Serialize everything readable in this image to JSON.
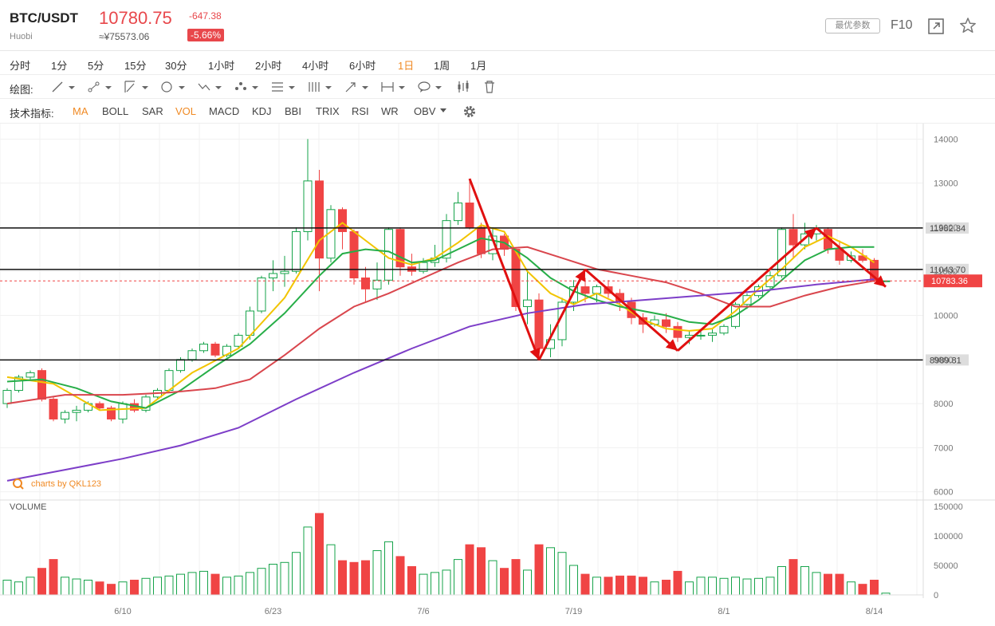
{
  "header": {
    "symbol": "BTC/USDT",
    "exchange": "Huobi",
    "price": "10780.75",
    "cny_price": "≈¥75573.06",
    "change": "-647.38",
    "change_pct": "-5.66%",
    "params_label": "最优参数",
    "f10_label": "F10",
    "icons": [
      "expand-icon",
      "star-icon"
    ]
  },
  "periods": [
    {
      "label": "分时",
      "active": false
    },
    {
      "label": "1分",
      "active": false
    },
    {
      "label": "5分",
      "active": false
    },
    {
      "label": "15分",
      "active": false
    },
    {
      "label": "30分",
      "active": false
    },
    {
      "label": "1小时",
      "active": false
    },
    {
      "label": "2小时",
      "active": false
    },
    {
      "label": "4小时",
      "active": false
    },
    {
      "label": "6小时",
      "active": false
    },
    {
      "label": "1日",
      "active": true
    },
    {
      "label": "1周",
      "active": false
    },
    {
      "label": "1月",
      "active": false
    }
  ],
  "drawing": {
    "label": "绘图:",
    "tools": [
      "line-tool-icon",
      "ray-tool-icon",
      "channel-tool-icon",
      "shape-tool-icon",
      "wave-tool-icon",
      "pattern-tool-icon",
      "fib-tool-icon",
      "gann-tool-icon",
      "arrow-tool-icon",
      "measure-tool-icon",
      "annotation-tool-icon",
      "candle-tool-icon",
      "trash-icon"
    ]
  },
  "indicators": {
    "label": "技术指标:",
    "items": [
      {
        "label": "MA",
        "active": true
      },
      {
        "label": "BOLL",
        "active": false
      },
      {
        "label": "SAR",
        "active": false
      },
      {
        "label": "VOL",
        "active": true
      },
      {
        "label": "MACD",
        "active": false
      },
      {
        "label": "KDJ",
        "active": false
      },
      {
        "label": "BBI",
        "active": false
      },
      {
        "label": "TRIX",
        "active": false
      },
      {
        "label": "RSI",
        "active": false
      },
      {
        "label": "WR",
        "active": false
      },
      {
        "label": "OBV",
        "active": false
      }
    ]
  },
  "colors": {
    "up": "#16a34a",
    "down": "#f04444",
    "ma5": "#f2c400",
    "ma10": "#27ae48",
    "ma30": "#d9464d",
    "ma60": "#7d3ec8",
    "annotation": "#e01010",
    "accent": "#f08a24"
  },
  "chart_data": {
    "type": "candlestick",
    "watermark": "charts by QKL123",
    "volume_label": "VOLUME",
    "price_axis": {
      "ticks": [
        "14000",
        "13000",
        "12000",
        "11000",
        "10000",
        "9000",
        "8000",
        "7000",
        "6000"
      ],
      "range": [
        5850,
        14350
      ]
    },
    "volume_axis": {
      "ticks": [
        "150000",
        "100000",
        "50000",
        "0"
      ],
      "range": [
        0,
        150000
      ]
    },
    "x_labels": [
      {
        "label": "6/10",
        "index": 10
      },
      {
        "label": "6/23",
        "index": 23
      },
      {
        "label": "7/6",
        "index": 36
      },
      {
        "label": "7/19",
        "index": 49
      },
      {
        "label": "8/1",
        "index": 62
      },
      {
        "label": "8/14",
        "index": 75
      }
    ],
    "horizontal_levels": [
      {
        "label": "11982.34",
        "value": 11982.34
      },
      {
        "label": "11043.70",
        "value": 11043.7
      },
      {
        "label": "8989.81",
        "value": 8989.81
      }
    ],
    "last_price": {
      "label": "10783.36",
      "value": 10783.36
    },
    "candles": [
      [
        8000,
        8300,
        8350,
        7900,
        25000
      ],
      [
        8300,
        8600,
        8650,
        8250,
        22000
      ],
      [
        8600,
        8700,
        8750,
        8550,
        30000
      ],
      [
        8750,
        8100,
        8800,
        8050,
        45000
      ],
      [
        8100,
        7650,
        8150,
        7600,
        60000
      ],
      [
        7650,
        7800,
        7850,
        7550,
        30000
      ],
      [
        7800,
        7850,
        7950,
        7600,
        27000
      ],
      [
        7850,
        8000,
        8050,
        7800,
        25000
      ],
      [
        8000,
        7900,
        8050,
        7850,
        22000
      ],
      [
        7900,
        7650,
        7950,
        7600,
        18000
      ],
      [
        7650,
        8000,
        8050,
        7550,
        22000
      ],
      [
        8000,
        7850,
        8100,
        7800,
        25000
      ],
      [
        7850,
        8150,
        8200,
        7800,
        28000
      ],
      [
        8150,
        8300,
        8350,
        8100,
        30000
      ],
      [
        8300,
        8750,
        8800,
        8250,
        32000
      ],
      [
        8750,
        9000,
        9050,
        8700,
        35000
      ],
      [
        9000,
        9200,
        9250,
        8950,
        38000
      ],
      [
        9200,
        9350,
        9400,
        9150,
        40000
      ],
      [
        9350,
        9100,
        9400,
        9050,
        35000
      ],
      [
        9100,
        9300,
        9350,
        9050,
        30000
      ],
      [
        9300,
        9550,
        9600,
        9250,
        32000
      ],
      [
        9550,
        10100,
        10200,
        9450,
        38000
      ],
      [
        10100,
        10850,
        10900,
        10050,
        45000
      ],
      [
        10850,
        10950,
        11250,
        10550,
        52000
      ],
      [
        10950,
        11000,
        11350,
        10650,
        55000
      ],
      [
        11000,
        11900,
        12000,
        10950,
        72000
      ],
      [
        11900,
        13050,
        14000,
        11700,
        115000
      ],
      [
        13050,
        11300,
        13300,
        10550,
        138000
      ],
      [
        11300,
        12400,
        12500,
        11200,
        85000
      ],
      [
        12400,
        11900,
        12450,
        11500,
        58000
      ],
      [
        11900,
        10850,
        11950,
        10700,
        55000
      ],
      [
        10850,
        10600,
        11100,
        10300,
        58000
      ],
      [
        10600,
        10800,
        11200,
        10350,
        75000
      ],
      [
        10800,
        11950,
        12000,
        10700,
        90000
      ],
      [
        11950,
        11100,
        12000,
        10900,
        65000
      ],
      [
        11100,
        11000,
        11400,
        10900,
        48000
      ],
      [
        11000,
        11200,
        11300,
        10950,
        35000
      ],
      [
        11200,
        11300,
        11600,
        11100,
        38000
      ],
      [
        11300,
        12150,
        12300,
        11200,
        42000
      ],
      [
        12150,
        12550,
        12800,
        12050,
        60000
      ],
      [
        12550,
        12000,
        13100,
        11950,
        85000
      ],
      [
        12000,
        11400,
        12100,
        11300,
        80000
      ],
      [
        11400,
        11800,
        12000,
        11250,
        58000
      ],
      [
        11800,
        11500,
        11850,
        11350,
        45000
      ],
      [
        11500,
        10200,
        11550,
        10100,
        60000
      ],
      [
        10200,
        10350,
        11000,
        9800,
        42000
      ],
      [
        10350,
        9250,
        10500,
        9100,
        85000
      ],
      [
        9250,
        9450,
        9800,
        9050,
        80000
      ],
      [
        9450,
        10300,
        10400,
        9300,
        72000
      ],
      [
        10300,
        10650,
        10800,
        10100,
        50000
      ],
      [
        10650,
        10500,
        10850,
        10300,
        35000
      ],
      [
        10500,
        10650,
        10700,
        10300,
        30000
      ],
      [
        10650,
        10500,
        10800,
        10400,
        30000
      ],
      [
        10500,
        10300,
        10600,
        10100,
        32000
      ],
      [
        10300,
        9950,
        10400,
        9800,
        32000
      ],
      [
        9950,
        9800,
        10050,
        9600,
        30000
      ],
      [
        9800,
        9900,
        10000,
        9750,
        22000
      ],
      [
        9900,
        9750,
        10050,
        9600,
        25000
      ],
      [
        9750,
        9500,
        9850,
        9400,
        40000
      ],
      [
        9500,
        9550,
        9650,
        9350,
        22000
      ],
      [
        9550,
        9550,
        9650,
        9450,
        30000
      ],
      [
        9550,
        9600,
        9700,
        9400,
        30000
      ],
      [
        9600,
        9750,
        9800,
        9550,
        28000
      ],
      [
        9750,
        10250,
        10300,
        9700,
        30000
      ],
      [
        10250,
        10450,
        10500,
        10150,
        27000
      ],
      [
        10450,
        10650,
        10700,
        10400,
        28000
      ],
      [
        10650,
        10900,
        11000,
        10600,
        30000
      ],
      [
        10900,
        11950,
        12000,
        10850,
        48000
      ],
      [
        11950,
        11600,
        12300,
        11300,
        60000
      ],
      [
        11600,
        11850,
        12100,
        11500,
        48000
      ],
      [
        11850,
        11950,
        12050,
        11700,
        38000
      ],
      [
        11950,
        11500,
        12000,
        11400,
        35000
      ],
      [
        11500,
        11250,
        11700,
        11150,
        35000
      ],
      [
        11250,
        11350,
        11450,
        11200,
        22000
      ],
      [
        11350,
        11250,
        11500,
        11200,
        18000
      ],
      [
        11250,
        10783,
        11300,
        10750,
        25000
      ],
      [
        10783,
        10783,
        10783,
        10783,
        3000
      ]
    ],
    "moving_averages": [
      {
        "key": "ma5",
        "values": [
          [
            0,
            8600
          ],
          [
            4,
            8450
          ],
          [
            8,
            7850
          ],
          [
            12,
            7900
          ],
          [
            16,
            8700
          ],
          [
            20,
            9250
          ],
          [
            24,
            10400
          ],
          [
            27,
            11700
          ],
          [
            29,
            12100
          ],
          [
            31,
            11700
          ],
          [
            33,
            11300
          ],
          [
            35,
            11150
          ],
          [
            37,
            11300
          ],
          [
            39,
            11650
          ],
          [
            41,
            12050
          ],
          [
            43,
            11900
          ],
          [
            45,
            11000
          ],
          [
            47,
            10500
          ],
          [
            49,
            10250
          ],
          [
            51,
            10500
          ],
          [
            53,
            10250
          ],
          [
            55,
            9900
          ],
          [
            57,
            9700
          ],
          [
            59,
            9650
          ],
          [
            61,
            9700
          ],
          [
            63,
            10100
          ],
          [
            65,
            10600
          ],
          [
            67,
            11050
          ],
          [
            69,
            11550
          ],
          [
            71,
            11800
          ],
          [
            73,
            11550
          ],
          [
            75,
            11200
          ]
        ]
      },
      {
        "key": "ma10",
        "values": [
          [
            0,
            8500
          ],
          [
            3,
            8550
          ],
          [
            6,
            8350
          ],
          [
            9,
            8050
          ],
          [
            12,
            7900
          ],
          [
            15,
            8300
          ],
          [
            18,
            8850
          ],
          [
            21,
            9350
          ],
          [
            24,
            10050
          ],
          [
            27,
            10900
          ],
          [
            29,
            11400
          ],
          [
            31,
            11500
          ],
          [
            33,
            11450
          ],
          [
            35,
            11200
          ],
          [
            37,
            11250
          ],
          [
            39,
            11500
          ],
          [
            41,
            11750
          ],
          [
            43,
            11650
          ],
          [
            45,
            11300
          ],
          [
            47,
            10850
          ],
          [
            49,
            10550
          ],
          [
            51,
            10350
          ],
          [
            53,
            10200
          ],
          [
            55,
            10100
          ],
          [
            57,
            10000
          ],
          [
            59,
            9850
          ],
          [
            61,
            9800
          ],
          [
            63,
            10000
          ],
          [
            65,
            10350
          ],
          [
            67,
            10800
          ],
          [
            69,
            11250
          ],
          [
            71,
            11500
          ],
          [
            73,
            11550
          ],
          [
            75,
            11550
          ]
        ]
      },
      {
        "key": "ma30",
        "values": [
          [
            0,
            8000
          ],
          [
            5,
            8200
          ],
          [
            10,
            8200
          ],
          [
            14,
            8250
          ],
          [
            18,
            8350
          ],
          [
            21,
            8550
          ],
          [
            24,
            9100
          ],
          [
            27,
            9700
          ],
          [
            30,
            10200
          ],
          [
            33,
            10500
          ],
          [
            36,
            10850
          ],
          [
            39,
            11200
          ],
          [
            42,
            11500
          ],
          [
            45,
            11550
          ],
          [
            48,
            11300
          ],
          [
            51,
            11050
          ],
          [
            54,
            10900
          ],
          [
            57,
            10750
          ],
          [
            60,
            10500
          ],
          [
            63,
            10200
          ],
          [
            66,
            10200
          ],
          [
            69,
            10450
          ],
          [
            72,
            10650
          ],
          [
            75,
            10783
          ]
        ]
      },
      {
        "key": "ma60",
        "values": [
          [
            0,
            6250
          ],
          [
            5,
            6500
          ],
          [
            10,
            6750
          ],
          [
            15,
            7050
          ],
          [
            20,
            7450
          ],
          [
            25,
            8100
          ],
          [
            30,
            8700
          ],
          [
            35,
            9250
          ],
          [
            40,
            9750
          ],
          [
            45,
            10050
          ],
          [
            50,
            10250
          ],
          [
            55,
            10350
          ],
          [
            60,
            10450
          ],
          [
            65,
            10550
          ],
          [
            70,
            10700
          ],
          [
            75,
            10820
          ]
        ]
      }
    ],
    "annotations": [
      {
        "points": [
          [
            40,
            13100
          ],
          [
            46,
            8989.81
          ],
          [
            50,
            11043.7
          ],
          [
            58,
            9200
          ],
          [
            70,
            11982.34
          ],
          [
            76,
            10650
          ]
        ]
      }
    ]
  }
}
